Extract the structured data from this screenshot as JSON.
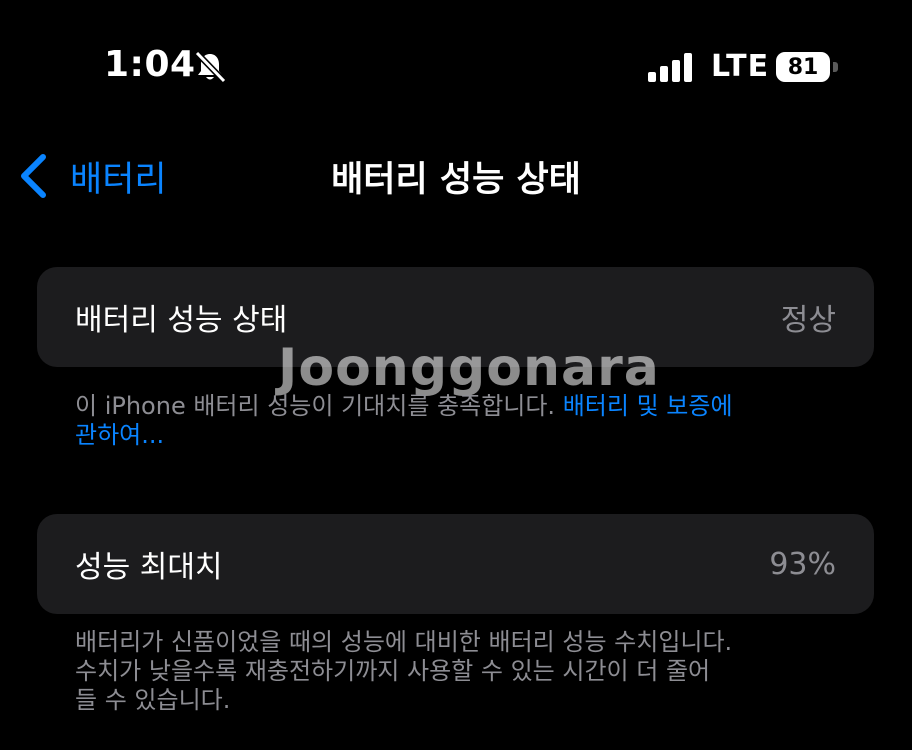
{
  "status_bar": {
    "time": "1:04",
    "network": "LTE",
    "battery_level": "81",
    "signal_bars": 4,
    "icons": [
      "bell-slash-icon",
      "cellular-signal-icon",
      "battery-icon"
    ]
  },
  "nav": {
    "back_label": "배터리",
    "title": "배터리 성능 상태",
    "back_icon": "chevron-left-icon"
  },
  "health_section": {
    "label": "배터리 성능 상태",
    "value": "정상",
    "footer_text": "이 iPhone 배터리 성능이 기대치를 충족합니다. ",
    "footer_link_part1": "배터리 및 보증에",
    "footer_link_part2": "관하여..."
  },
  "capacity_section": {
    "label": "성능 최대치",
    "value": "93%",
    "footer_lines": [
      "배터리가 신품이었을 때의 성능에 대비한 배터리 성능 수치입니다.",
      "수치가 낮을수록 재충전하기까지 사용할 수 있는 시간이 더 줄어",
      "들 수 있습니다."
    ]
  },
  "watermark": "Joonggonara",
  "colors": {
    "background": "#000000",
    "cell": "#1c1c1e",
    "accent": "#0a84ff",
    "secondary_text": "#8d8d93"
  }
}
